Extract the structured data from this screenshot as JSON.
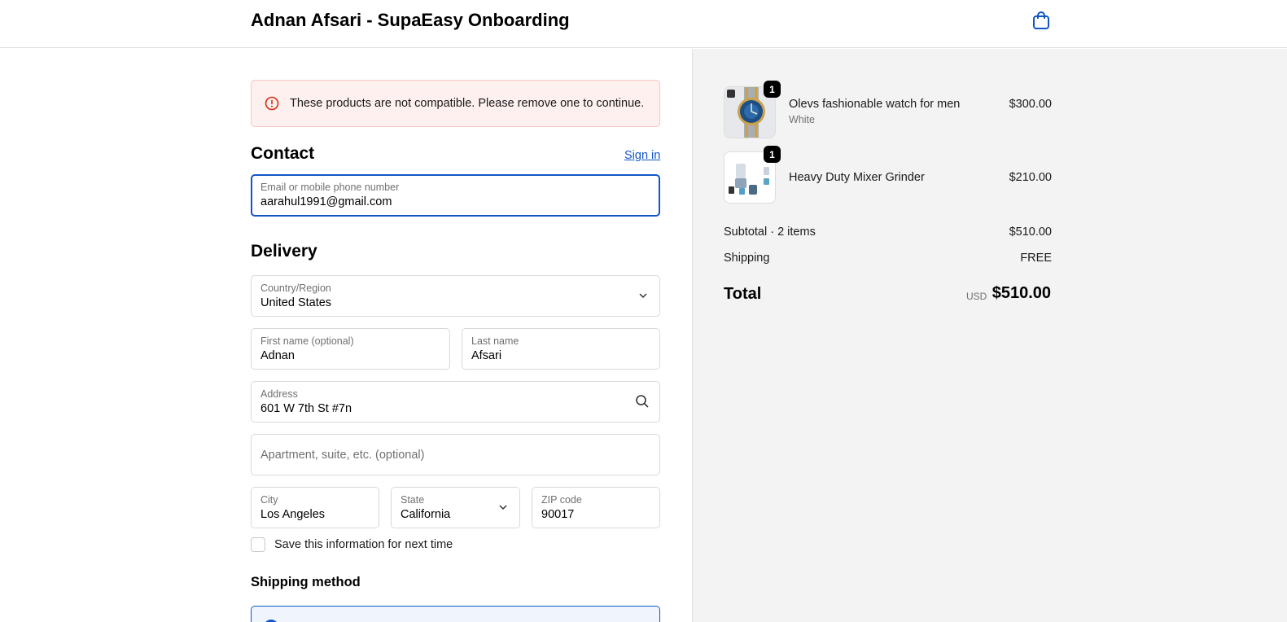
{
  "header": {
    "store_title": "Adnan Afsari - SupaEasy Onboarding",
    "cart_icon": "shopping-bag-icon",
    "accent_color": "#1256c5"
  },
  "alert": {
    "icon": "error-circle-icon",
    "message": "These products are not compatible. Please remove one to continue.",
    "color": "#d72c0d"
  },
  "contact": {
    "heading": "Contact",
    "sign_in": "Sign in",
    "email_label": "Email or mobile phone number",
    "email_value": "aarahul1991@gmail.com"
  },
  "delivery": {
    "heading": "Delivery",
    "country_label": "Country/Region",
    "country_value": "United States",
    "first_name_label": "First name (optional)",
    "first_name_value": "Adnan",
    "last_name_label": "Last name",
    "last_name_value": "Afsari",
    "address_label": "Address",
    "address_value": "601 W 7th St #7n",
    "apartment_placeholder": "Apartment, suite, etc. (optional)",
    "city_label": "City",
    "city_value": "Los Angeles",
    "state_label": "State",
    "state_value": "California",
    "zip_label": "ZIP code",
    "zip_value": "90017",
    "save_info": "Save this information for next time"
  },
  "shipping": {
    "heading": "Shipping method"
  },
  "order": {
    "items": [
      {
        "name": "Olevs fashionable watch for men",
        "variant": "White",
        "price": "$300.00",
        "quantity": "1"
      },
      {
        "name": "Heavy Duty Mixer Grinder",
        "variant": "",
        "price": "$210.00",
        "quantity": "1"
      }
    ],
    "subtotal_label": "Subtotal · 2 items",
    "subtotal_value": "$510.00",
    "shipping_label": "Shipping",
    "shipping_value": "FREE",
    "total_label": "Total",
    "total_currency": "USD",
    "total_value": "$510.00"
  }
}
